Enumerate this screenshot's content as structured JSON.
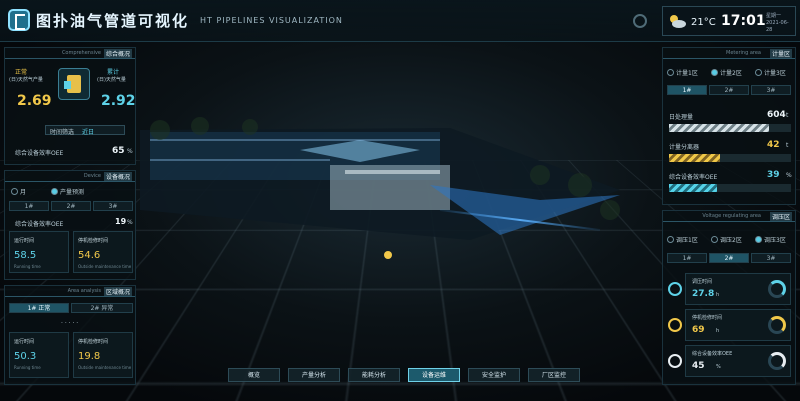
{
  "header": {
    "title": "图扑油气管道可视化",
    "subtitle": "HT PIPELINES VISUALIZATION",
    "weather": {
      "temperature": "21°C",
      "time": "17:01",
      "date_line1": "星期一",
      "date_line2": "2021-06-28"
    }
  },
  "left_panel1": {
    "header_en": "Comprehensive",
    "header_zh": "综合概况",
    "label_left": "正常",
    "sub_left": "(日)天然气产量",
    "value_left": "2.69",
    "label_right": "累计",
    "sub_right": "(日)天然气量",
    "value_right": "2.92",
    "select_label": "时间筛选",
    "select_value": "近日",
    "oee_label": "综合设备效率OEE",
    "oee_value": "65",
    "oee_unit": "%"
  },
  "left_panel2": {
    "header_en": "Device",
    "header_zh": "设备概况",
    "radio1": "月",
    "radio2": "产量预测",
    "tabs": [
      "1#",
      "2#",
      "3#"
    ],
    "oee_label": "综合设备效率OEE",
    "oee_value": "19",
    "oee_unit": "%",
    "card1_label": "运行时间",
    "card1_value": "58.5",
    "card1_sub": "Running time",
    "card2_label": "停机检修时间",
    "card2_value": "54.6",
    "card2_sub": "Outside maintenance time"
  },
  "left_panel3": {
    "header_en": "Area analysis",
    "header_zh": "区域概况",
    "tab1": "1# 正常",
    "tab2": "2# 异常",
    "dots": "· · · · ·",
    "card1_label": "运行时间",
    "card1_value": "50.3",
    "card1_sub": "Running time",
    "card2_label": "停机检修时间",
    "card2_value": "19.8",
    "card2_sub": "Outside maintenance time"
  },
  "right_panel1": {
    "header_en": "Metering area",
    "header_zh": "计量区",
    "radios": [
      "计量1区",
      "计量2区",
      "计量3区"
    ],
    "tabs": [
      "1#",
      "2#",
      "3#"
    ],
    "rows": [
      {
        "label": "日处理量",
        "value": "604",
        "unit": "t",
        "fill": 0.82,
        "style": "white"
      },
      {
        "label": "计量分离器",
        "value": "42",
        "unit": "t",
        "fill": 0.42,
        "style": "yellow"
      },
      {
        "label": "综合设备效率OEE",
        "value": "39",
        "unit": "%",
        "fill": 0.39,
        "style": "cyan"
      }
    ]
  },
  "right_panel2": {
    "header_en": "Voltage regulating area",
    "header_zh": "调压区",
    "radios": [
      "调压1区",
      "调压2区",
      "调压3区"
    ],
    "tabs": [
      "1#",
      "2#",
      "3#"
    ],
    "metrics": [
      {
        "label": "调压时间",
        "value": "27.8",
        "unit": "h",
        "fill": 0.6,
        "color": "#5ed2e8"
      },
      {
        "label": "停机检修时间",
        "value": "69",
        "unit": "h",
        "fill": 0.69,
        "color": "#f1c84a"
      },
      {
        "label": "综合设备效率OEE",
        "value": "45",
        "unit": "%",
        "fill": 0.45,
        "color": "#e8eef2"
      }
    ]
  },
  "bottom_nav": {
    "items": [
      "概览",
      "产量分析",
      "能耗分析",
      "设备运维",
      "安全监护",
      "厂区监控"
    ],
    "active_index": 3
  },
  "colors": {
    "accent": "#5ed2e8",
    "warn": "#f1c84a",
    "panel": "#08101400"
  }
}
